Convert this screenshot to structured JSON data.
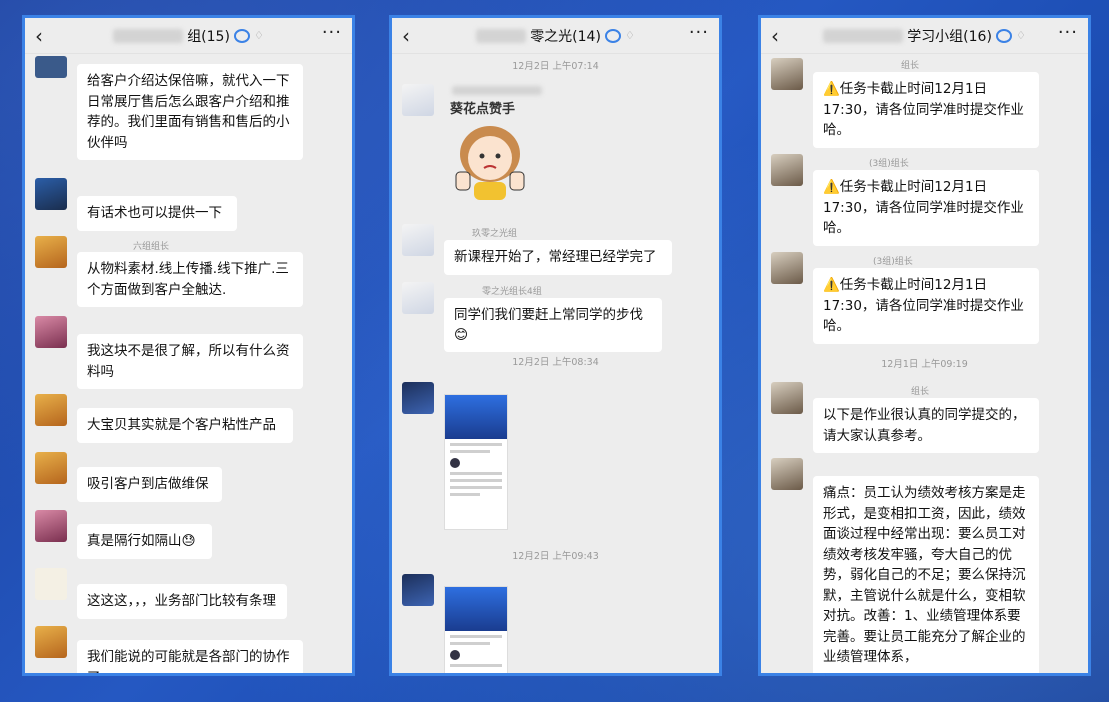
{
  "panels": [
    {
      "title": "组(15)",
      "messages": [
        {
          "sender": "",
          "text": "给客户介绍达保倍嘛，就代入一下日常展厅售后怎么跟客户介绍和推荐的。我们里面有销售和售后的小伙伴吗"
        },
        {
          "sender": "",
          "text": "有话术也可以提供一下"
        },
        {
          "sender": "六组组长",
          "text": "从物料素材.线上传播.线下推广.三个方面做到客户全触达."
        },
        {
          "sender": "",
          "text": "我这块不是很了解，所以有什么资料吗"
        },
        {
          "sender": "",
          "text": "大宝贝其实就是个客户粘性产品"
        },
        {
          "sender": "",
          "text": "吸引客户到店做维保"
        },
        {
          "sender": "",
          "text": "真是隔行如隔山😓"
        },
        {
          "sender": "",
          "text": "这这这，，，业务部门比较有条理"
        },
        {
          "sender": "",
          "text": "我们能说的可能就是各部门的协作了"
        }
      ]
    },
    {
      "title": "零之光(14)",
      "times": [
        "12月2日 上午07:14",
        "12月2日 上午08:34",
        "12月2日 上午09:43"
      ],
      "sticker_caption": "葵花点赞手",
      "messages": [
        {
          "sender": "玖零之光组",
          "text": "新课程开始了，常经理已经学完了"
        },
        {
          "sender": "零之光组长4组",
          "text": "同学们我们要赶上常同学的步伐"
        },
        {
          "sender": "",
          "text": "😊"
        }
      ]
    },
    {
      "title": "学习小组(16)",
      "times": [
        "12月1日 上午09:19"
      ],
      "messages": [
        {
          "sender": "组长",
          "text": "⚠️任务卡截止时间12月1日17:30，请各位同学准时提交作业哈。"
        },
        {
          "sender": "(3组)组长",
          "text": "⚠️任务卡截止时间12月1日17:30，请各位同学准时提交作业哈。"
        },
        {
          "sender": "(3组)组长",
          "text": "⚠️任务卡截止时间12月1日17:30，请各位同学准时提交作业哈。"
        },
        {
          "sender": "组长",
          "text": "以下是作业很认真的同学提交的，请大家认真参考。"
        },
        {
          "sender": "",
          "text": "痛点：员工认为绩效考核方案是走形式，是变相扣工资，因此，绩效面谈过程中经常出现：要么员工对绩效考核发牢骚，夸大自己的优势，弱化自己的不足；要么保持沉默，主管说什么就是什么，变相软对抗。改善：1、业绩管理体系要完善。要让员工能充分了解企业的业绩管理体系，"
        }
      ]
    }
  ],
  "icons": {
    "back": "back-arrow-icon",
    "more": "more-dots-icon",
    "mute": "mute-bell-icon",
    "group": "group-chat-icon"
  },
  "colors": {
    "accent": "#3b82e6",
    "background": "#1f4db0",
    "chat_bg": "#ededed",
    "bubble": "#ffffff"
  }
}
